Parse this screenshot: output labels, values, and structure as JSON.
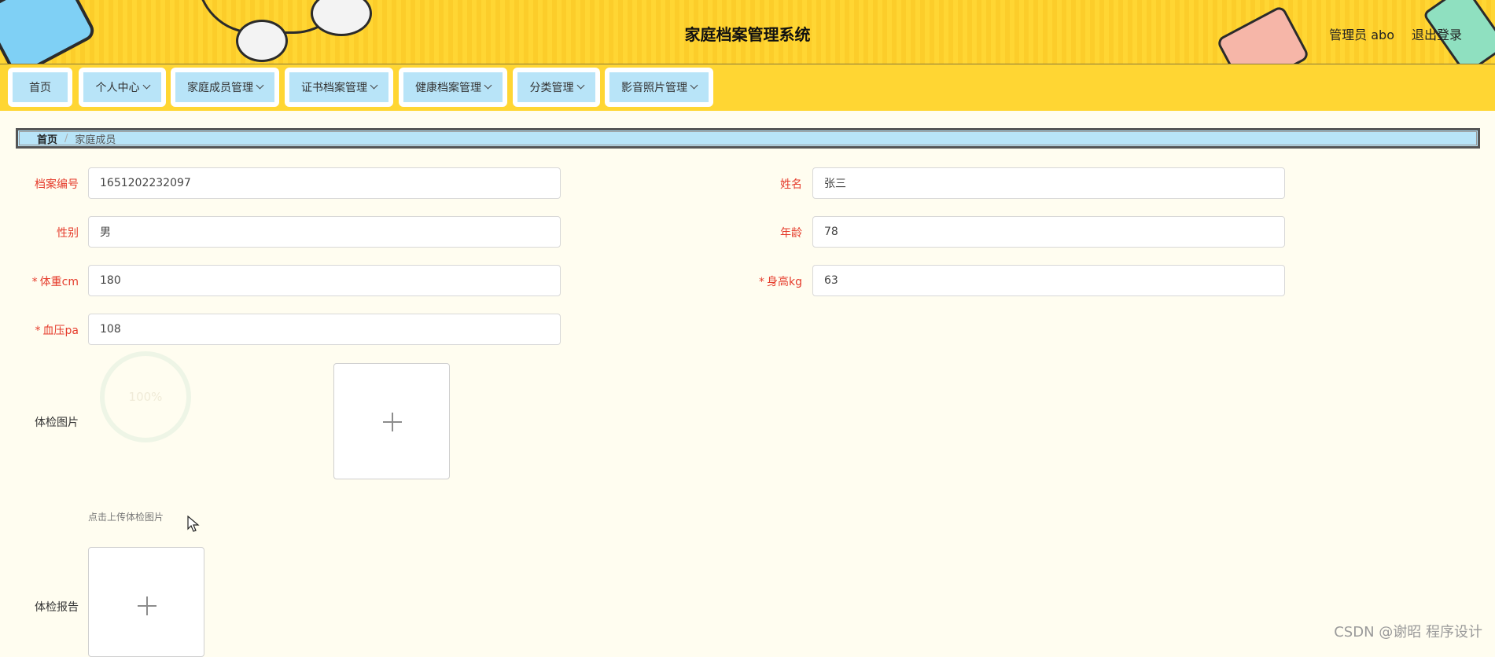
{
  "header": {
    "title": "家庭档案管理系统",
    "user": "管理员 abo",
    "logout": "退出登录"
  },
  "nav": [
    {
      "label": "首页",
      "dropdown": false
    },
    {
      "label": "个人中心",
      "dropdown": true
    },
    {
      "label": "家庭成员管理",
      "dropdown": true
    },
    {
      "label": "证书档案管理",
      "dropdown": true
    },
    {
      "label": "健康档案管理",
      "dropdown": true
    },
    {
      "label": "分类管理",
      "dropdown": true
    },
    {
      "label": "影音照片管理",
      "dropdown": true
    }
  ],
  "breadcrumb": {
    "home": "首页",
    "current": "家庭成员"
  },
  "form": {
    "archive_no": {
      "label": "档案编号",
      "value": "1651202232097"
    },
    "name": {
      "label": "姓名",
      "value": "张三"
    },
    "gender": {
      "label": "性别",
      "value": "男"
    },
    "age": {
      "label": "年龄",
      "value": "78"
    },
    "weight": {
      "label": "体重cm",
      "value": "180",
      "required": true
    },
    "height": {
      "label": "身高kg",
      "value": "63",
      "required": true
    },
    "blood_pressure": {
      "label": "血压pa",
      "value": "108",
      "required": true
    },
    "exam_image": {
      "label": "体检图片",
      "tip": "点击上传体检图片",
      "progress": "100%"
    },
    "exam_report": {
      "label": "体检报告"
    }
  },
  "required_mark": "*",
  "watermark": "CSDN @谢昭  程序设计",
  "colors": {
    "header_bg": "#ffd633",
    "nav_item_bg": "#b8e4f8",
    "label_red": "#e53b2b",
    "page_bg": "#fffdf0"
  }
}
